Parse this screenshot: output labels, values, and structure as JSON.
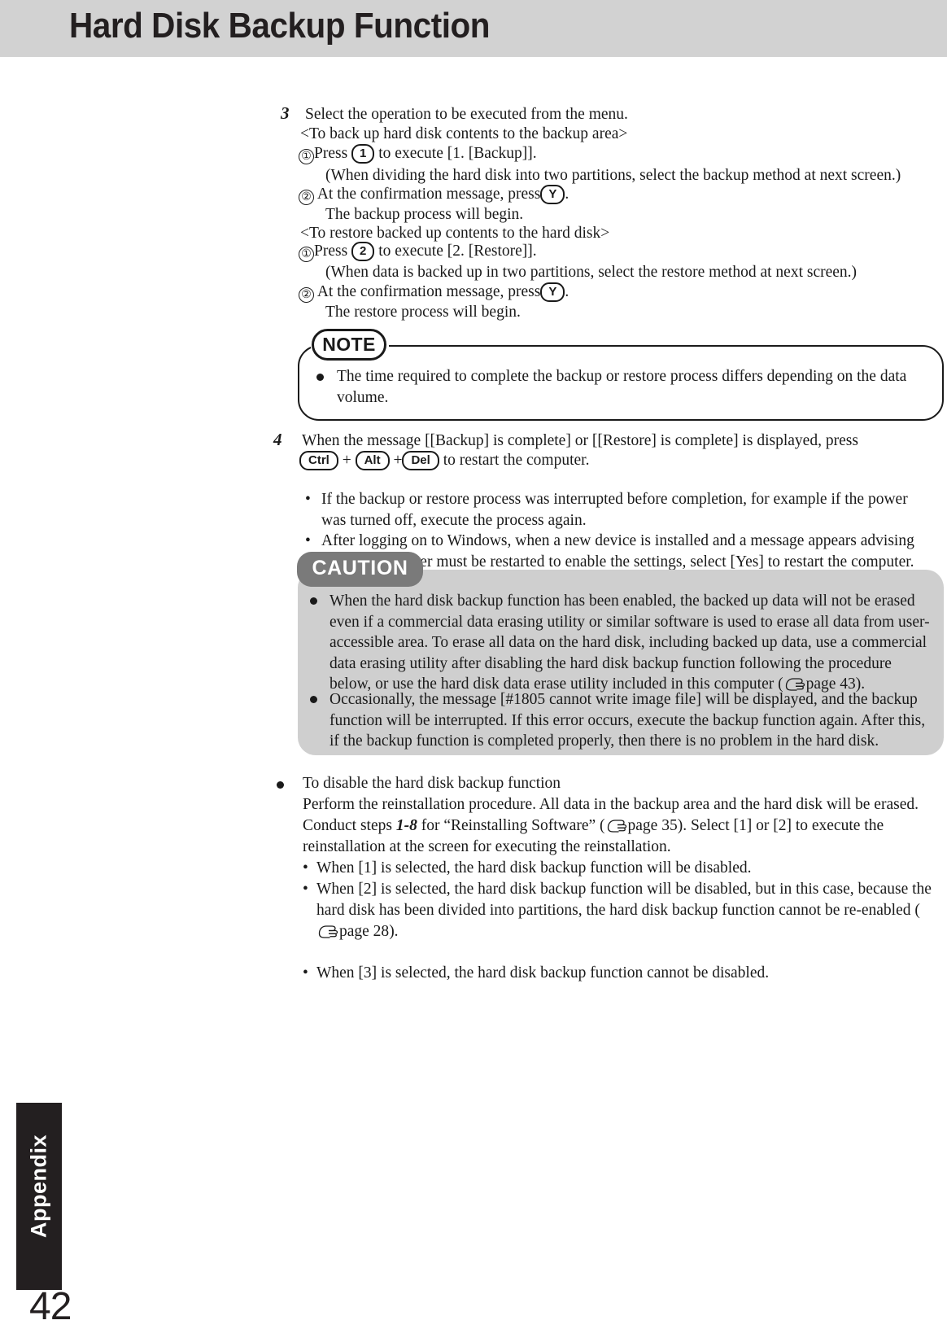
{
  "header": {
    "title": "Hard Disk Backup Function"
  },
  "icons": {
    "pointing_hand": "pointing-hand-icon",
    "bullet": "bullet-icon"
  },
  "steps": [
    {
      "number": "3",
      "intro": "Select the operation to be executed from the menu.",
      "groups": [
        {
          "heading": "<To back up hard disk contents to the backup area>",
          "items": [
            {
              "marker": "①",
              "pre": "Press",
              "key": "1",
              "post": "to execute [1. [Backup]].",
              "sub": "(When dividing the hard disk into two partitions, select the backup method at next screen.)"
            },
            {
              "marker": "②",
              "pre": "At the confirmation message, press",
              "key": "Y",
              "post": ".",
              "sub": "The backup process will begin."
            }
          ]
        },
        {
          "heading": "<To restore backed up contents to the hard disk>",
          "items": [
            {
              "marker": "①",
              "pre": "Press",
              "key": "2",
              "post": "to execute [2. [Restore]].",
              "sub": "(When data is backed up in two partitions, select the restore method at next screen.)"
            },
            {
              "marker": "②",
              "pre": "At the confirmation message, press",
              "key": "Y",
              "post": ".",
              "sub": "The restore process will begin."
            }
          ]
        }
      ]
    }
  ],
  "note_box": {
    "label": "NOTE",
    "bullets": [
      "The time required to complete the backup or restore process differs depending on the data volume."
    ]
  },
  "step4": {
    "number": "4",
    "line1": "When the message [[Backup] is complete] or [[Restore] is complete] is displayed, press",
    "keys": [
      "Ctrl",
      "Alt",
      "Del"
    ],
    "plus": "+",
    "line2_tail": "to restart the computer.",
    "bullets": [
      "If the backup or restore process was interrupted before completion, for example if the power was turned off, execute the process again.",
      "After logging on to Windows, when a new device is installed and a message appears advising that the computer must be restarted to enable the settings, select [Yes] to restart the computer."
    ]
  },
  "caution_box": {
    "label": "CAUTION",
    "bullets": [
      {
        "text_a": "When the hard disk backup function has been enabled, the backed up data will not be erased even if a commercial data erasing utility or similar software is used to erase all data from user-accessible area. To erase all data on the hard disk, including backed up data, use a commercial data erasing utility after disabling the hard disk backup function following the procedure below, or use the hard disk data erase utility included in this computer (",
        "page_ref": "page 43",
        "text_b": ")."
      },
      {
        "text_a": "Occasionally, the message [#1805 cannot write image file] will be displayed, and the backup function will be interrupted.  If this error occurs, execute the backup function again.  After this, if the backup function is completed properly, then there is no problem in the hard disk.",
        "page_ref": "",
        "text_b": ""
      }
    ]
  },
  "disable_section": {
    "title": "To disable the hard disk backup function",
    "line1": "Perform the reinstallation procedure. All data in the backup area and the hard disk will be erased.",
    "line2_a": "Conduct steps ",
    "line2_bold": "1-8",
    "line2_b": " for “Reinstalling Software” (",
    "line2_ref": "page 35",
    "line2_c": "). Select [1] or [2] to execute the reinstallation at the screen for executing the reinstallation.",
    "sub_bullets": [
      {
        "text_a": "When [1] is selected, the hard disk backup function will be disabled.",
        "page_ref": "",
        "text_b": ""
      },
      {
        "text_a": "When [2] is selected, the hard disk backup function will be disabled, but in this case, because the hard disk has been divided into partitions, the hard disk backup function cannot be re-enabled (",
        "page_ref": "page 28",
        "text_b": ")."
      },
      {
        "text_a": "When [3] is selected, the hard disk backup function cannot be disabled.",
        "page_ref": "",
        "text_b": ""
      }
    ]
  },
  "footer": {
    "tab_label": "Appendix",
    "page_number": "42"
  }
}
